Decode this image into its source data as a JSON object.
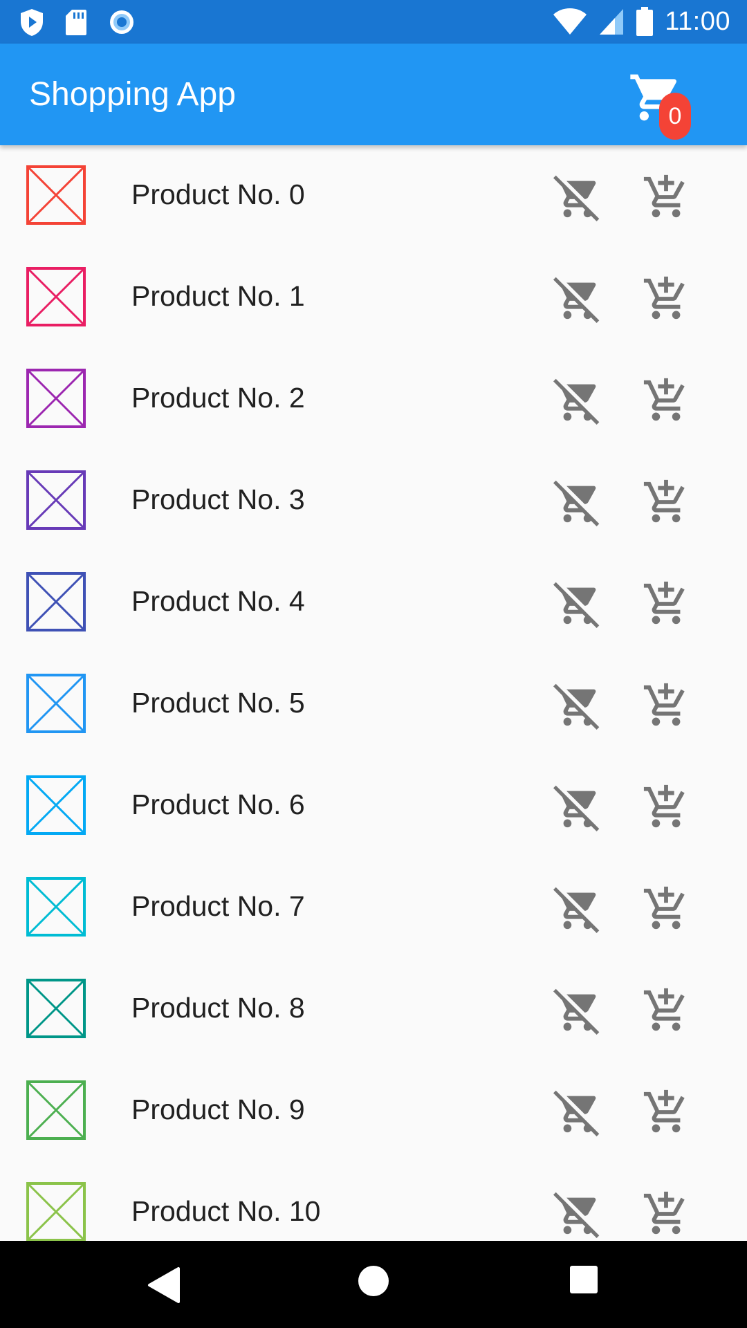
{
  "status_bar": {
    "time": "11:00",
    "icons": [
      "play-protect-icon",
      "sd-card-icon",
      "record-icon",
      "wifi-icon",
      "signal-icon",
      "battery-icon"
    ]
  },
  "app_bar": {
    "title": "Shopping App",
    "cart_count": "0",
    "cart_icon": "shopping-cart-icon"
  },
  "products": [
    {
      "name": "Product No. 0",
      "color": "#f44336"
    },
    {
      "name": "Product No. 1",
      "color": "#e91e63"
    },
    {
      "name": "Product No. 2",
      "color": "#9c27b0"
    },
    {
      "name": "Product No. 3",
      "color": "#673ab7"
    },
    {
      "name": "Product No. 4",
      "color": "#3f51b5"
    },
    {
      "name": "Product No. 5",
      "color": "#2196f3"
    },
    {
      "name": "Product No. 6",
      "color": "#03a9f4"
    },
    {
      "name": "Product No. 7",
      "color": "#00bcd4"
    },
    {
      "name": "Product No. 8",
      "color": "#009688"
    },
    {
      "name": "Product No. 9",
      "color": "#4caf50"
    },
    {
      "name": "Product No. 10",
      "color": "#8bc34a"
    }
  ],
  "item_icons": {
    "remove": "remove-from-cart-icon",
    "add": "add-to-cart-icon",
    "icon_color": "#757575"
  },
  "nav_bar": {
    "icons": [
      "back-icon",
      "home-icon",
      "recents-icon"
    ]
  }
}
